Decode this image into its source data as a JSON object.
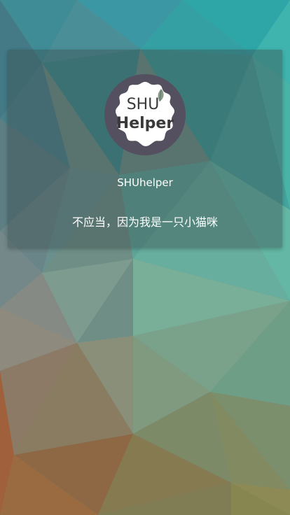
{
  "profile": {
    "logo": {
      "line1": "SHU",
      "line2": "Helper"
    },
    "name": "SHUhelper",
    "tagline": "不应当，因为我是一只小猫咪"
  },
  "colors": {
    "logo_ring": "#54505f",
    "logo_text": "#3a3a3a",
    "card_overlay": "rgba(60,78,82,0.42)",
    "text": "#ffffff"
  },
  "icons": {
    "logo": "shuhelper-logo-icon",
    "leaf": "leaf-icon"
  }
}
